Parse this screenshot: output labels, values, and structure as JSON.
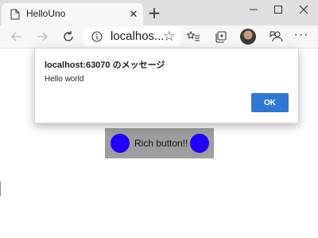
{
  "browser": {
    "tab": {
      "title": "HelloUno",
      "close_glyph": "✕"
    },
    "new_tab_glyph": "+",
    "address": {
      "url": "localhos...",
      "star_glyph": "☆"
    },
    "more_glyph": "···",
    "icons": [
      "page-icon",
      "back-icon",
      "forward-icon",
      "refresh-icon",
      "info-icon",
      "star-icon",
      "favorites-icon",
      "collections-icon",
      "feedback-icon",
      "more-icon",
      "minimize-icon",
      "maximize-icon",
      "close-icon"
    ]
  },
  "dialog": {
    "title": "localhost:63070 のメッセージ",
    "message": "Hello world",
    "ok_label": "OK"
  },
  "page": {
    "rich_button_label": "Rich button!!"
  },
  "colors": {
    "dot": "#2200ff",
    "rich_button_bg": "#9e9e9e",
    "ok_button": "#2f78d6"
  }
}
